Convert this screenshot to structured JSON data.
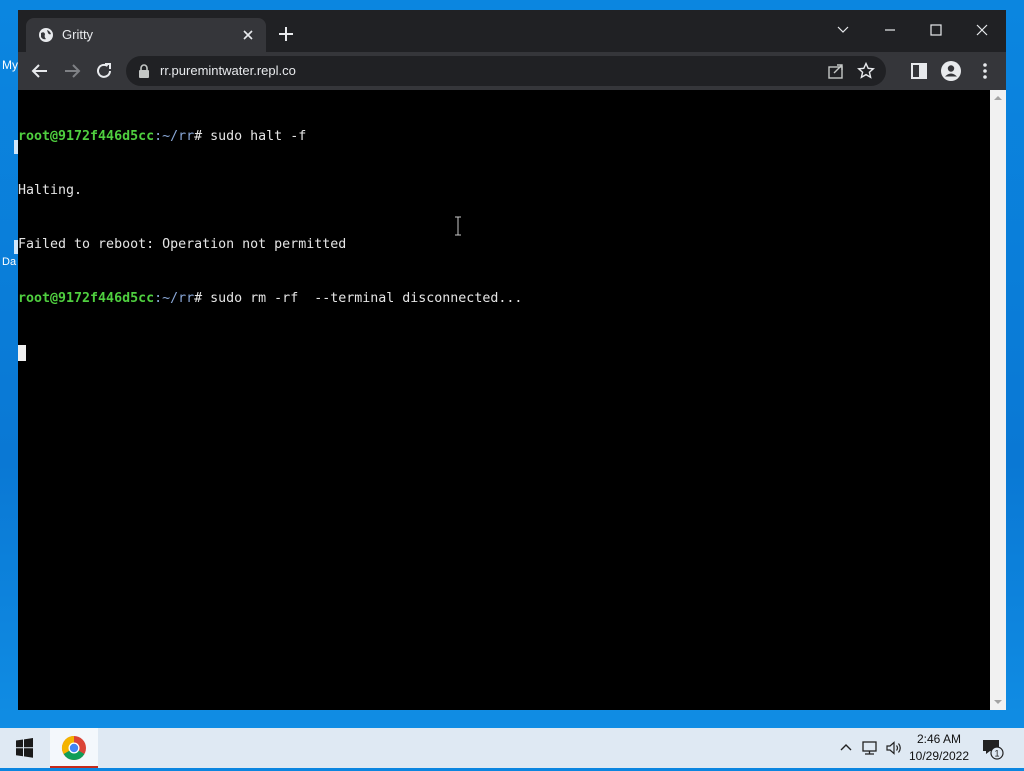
{
  "desktop": {
    "label_top": "My",
    "label_bottom": "Da"
  },
  "browser": {
    "tab_title": "Gritty",
    "url": "rr.puremintwater.repl.co"
  },
  "terminal": {
    "lines": [
      {
        "user": "root@9172f446d5cc",
        "path": ":~/rr",
        "cmd": "# sudo halt -f"
      },
      {
        "text": "Halting."
      },
      {
        "text": "Failed to reboot: Operation not permitted"
      },
      {
        "user": "root@9172f446d5cc",
        "path": ":~/rr",
        "cmd": "# sudo rm -rf  --terminal disconnected..."
      }
    ]
  },
  "taskbar": {
    "time": "2:46 AM",
    "date": "10/29/2022",
    "notification_count": "1"
  },
  "icons": {
    "tab": "globe-icon",
    "window": [
      "chevron-down-icon",
      "minimize-icon",
      "maximize-icon",
      "close-icon"
    ],
    "toolbar": [
      "back-icon",
      "forward-icon",
      "reload-icon",
      "lock-icon",
      "share-icon",
      "star-icon",
      "side-panel-icon",
      "profile-icon",
      "menu-icon"
    ],
    "taskbar": [
      "windows-start-icon",
      "chrome-icon",
      "chevron-up-icon",
      "network-icon",
      "volume-icon",
      "notification-icon"
    ]
  },
  "colors": {
    "desktop": "#0a78d4",
    "terminal_bg": "#000000",
    "prompt_user": "#4fcf3f",
    "prompt_path": "#8aa8d8",
    "browser_frame": "#202124"
  }
}
